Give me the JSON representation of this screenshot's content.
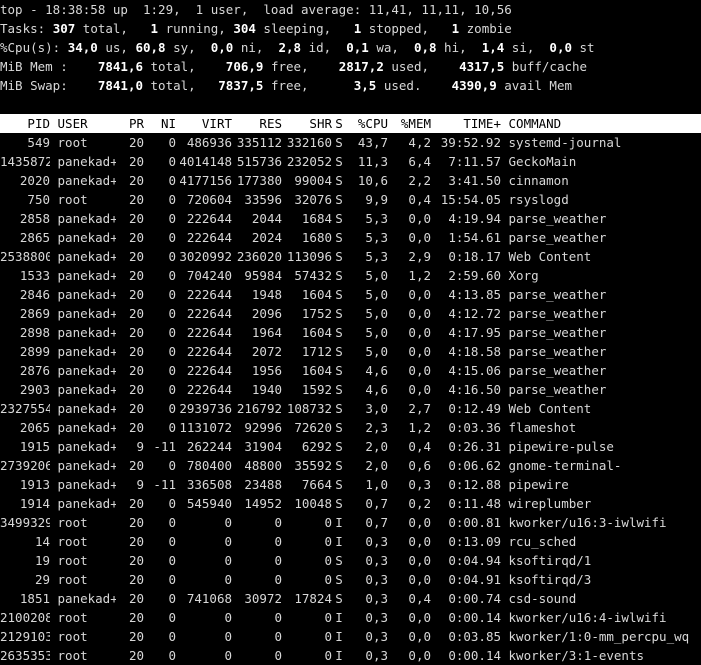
{
  "summary": {
    "line1": "top - 18:38:58 up  1:29,  1 user,  load average: 11,41, 11,11, 10,56",
    "tasks": {
      "label": "Tasks: ",
      "total": "307",
      "total_label": " total,   ",
      "running": "1",
      "running_label": " running, ",
      "sleeping": "304",
      "sleeping_label": " sleeping,   ",
      "stopped": "1",
      "stopped_label": " stopped,   ",
      "zombie": "1",
      "zombie_label": " zombie"
    },
    "cpu": {
      "label": "%Cpu(s): ",
      "us": "34,0",
      "us_label": " us, ",
      "sy": "60,8",
      "sy_label": " sy,  ",
      "ni": "0,0",
      "ni_label": " ni,  ",
      "id": "2,8",
      "id_label": " id,  ",
      "wa": "0,1",
      "wa_label": " wa,  ",
      "hi": "0,8",
      "hi_label": " hi,  ",
      "si": "1,4",
      "si_label": " si,  ",
      "st": "0,0",
      "st_label": " st"
    },
    "mem": {
      "label": "MiB Mem :    ",
      "total": "7841,6",
      "total_label": " total,    ",
      "free": "706,9",
      "free_label": " free,    ",
      "used": "2817,2",
      "used_label": " used,    ",
      "buff": "4317,5",
      "buff_label": " buff/cache"
    },
    "swap": {
      "label": "MiB Swap:    ",
      "total": "7841,0",
      "total_label": " total,   ",
      "free": "7837,5",
      "free_label": " free,      ",
      "used": "3,5",
      "used_label": " used.    ",
      "avail": "4390,9",
      "avail_label": " avail Mem"
    }
  },
  "columns": [
    "PID",
    "USER",
    "PR",
    "NI",
    "VIRT",
    "RES",
    "SHR",
    "S",
    "%CPU",
    "%MEM",
    "TIME+",
    "COMMAND"
  ],
  "processes": [
    [
      "549",
      "root",
      "20",
      "0",
      "486936",
      "335112",
      "332160",
      "S",
      "43,7",
      "4,2",
      "39:52.92",
      "systemd-journal"
    ],
    [
      "1435872",
      "panekad+",
      "20",
      "0",
      "4014148",
      "515736",
      "232052",
      "S",
      "11,3",
      "6,4",
      "7:11.57",
      "GeckoMain"
    ],
    [
      "2020",
      "panekad+",
      "20",
      "0",
      "4177156",
      "177380",
      "99004",
      "S",
      "10,6",
      "2,2",
      "3:41.50",
      "cinnamon"
    ],
    [
      "750",
      "root",
      "20",
      "0",
      "720604",
      "33596",
      "32076",
      "S",
      "9,9",
      "0,4",
      "15:54.05",
      "rsyslogd"
    ],
    [
      "2858",
      "panekad+",
      "20",
      "0",
      "222644",
      "2044",
      "1684",
      "S",
      "5,3",
      "0,0",
      "4:19.94",
      "parse_weather"
    ],
    [
      "2865",
      "panekad+",
      "20",
      "0",
      "222644",
      "2024",
      "1680",
      "S",
      "5,3",
      "0,0",
      "1:54.61",
      "parse_weather"
    ],
    [
      "2538800",
      "panekad+",
      "20",
      "0",
      "3020992",
      "236020",
      "113096",
      "S",
      "5,3",
      "2,9",
      "0:18.17",
      "Web Content"
    ],
    [
      "1533",
      "panekad+",
      "20",
      "0",
      "704240",
      "95984",
      "57432",
      "S",
      "5,0",
      "1,2",
      "2:59.60",
      "Xorg"
    ],
    [
      "2846",
      "panekad+",
      "20",
      "0",
      "222644",
      "1948",
      "1604",
      "S",
      "5,0",
      "0,0",
      "4:13.85",
      "parse_weather"
    ],
    [
      "2869",
      "panekad+",
      "20",
      "0",
      "222644",
      "2096",
      "1752",
      "S",
      "5,0",
      "0,0",
      "4:12.72",
      "parse_weather"
    ],
    [
      "2898",
      "panekad+",
      "20",
      "0",
      "222644",
      "1964",
      "1604",
      "S",
      "5,0",
      "0,0",
      "4:17.95",
      "parse_weather"
    ],
    [
      "2899",
      "panekad+",
      "20",
      "0",
      "222644",
      "2072",
      "1712",
      "S",
      "5,0",
      "0,0",
      "4:18.58",
      "parse_weather"
    ],
    [
      "2876",
      "panekad+",
      "20",
      "0",
      "222644",
      "1956",
      "1604",
      "S",
      "4,6",
      "0,0",
      "4:15.06",
      "parse_weather"
    ],
    [
      "2903",
      "panekad+",
      "20",
      "0",
      "222644",
      "1940",
      "1592",
      "S",
      "4,6",
      "0,0",
      "4:16.50",
      "parse_weather"
    ],
    [
      "2327554",
      "panekad+",
      "20",
      "0",
      "2939736",
      "216792",
      "108732",
      "S",
      "3,0",
      "2,7",
      "0:12.49",
      "Web Content"
    ],
    [
      "2065",
      "panekad+",
      "20",
      "0",
      "1131072",
      "92996",
      "72620",
      "S",
      "2,3",
      "1,2",
      "0:03.36",
      "flameshot"
    ],
    [
      "1915",
      "panekad+",
      "9",
      "-11",
      "262244",
      "31904",
      "6292",
      "S",
      "2,0",
      "0,4",
      "0:26.31",
      "pipewire-pulse"
    ],
    [
      "2739206",
      "panekad+",
      "20",
      "0",
      "780400",
      "48800",
      "35592",
      "S",
      "2,0",
      "0,6",
      "0:06.62",
      "gnome-terminal-"
    ],
    [
      "1913",
      "panekad+",
      "9",
      "-11",
      "336508",
      "23488",
      "7664",
      "S",
      "1,0",
      "0,3",
      "0:12.88",
      "pipewire"
    ],
    [
      "1914",
      "panekad+",
      "20",
      "0",
      "545940",
      "14952",
      "10048",
      "S",
      "0,7",
      "0,2",
      "0:11.48",
      "wireplumber"
    ],
    [
      "3499329",
      "root",
      "20",
      "0",
      "0",
      "0",
      "0",
      "I",
      "0,7",
      "0,0",
      "0:00.81",
      "kworker/u16:3-iwlwifi"
    ],
    [
      "14",
      "root",
      "20",
      "0",
      "0",
      "0",
      "0",
      "I",
      "0,3",
      "0,0",
      "0:13.09",
      "rcu_sched"
    ],
    [
      "19",
      "root",
      "20",
      "0",
      "0",
      "0",
      "0",
      "S",
      "0,3",
      "0,0",
      "0:04.94",
      "ksoftirqd/1"
    ],
    [
      "29",
      "root",
      "20",
      "0",
      "0",
      "0",
      "0",
      "S",
      "0,3",
      "0,0",
      "0:04.91",
      "ksoftirqd/3"
    ],
    [
      "1851",
      "panekad+",
      "20",
      "0",
      "741068",
      "30972",
      "17824",
      "S",
      "0,3",
      "0,4",
      "0:00.74",
      "csd-sound"
    ],
    [
      "2100208",
      "root",
      "20",
      "0",
      "0",
      "0",
      "0",
      "I",
      "0,3",
      "0,0",
      "0:00.14",
      "kworker/u16:4-iwlwifi"
    ],
    [
      "2129103",
      "root",
      "20",
      "0",
      "0",
      "0",
      "0",
      "I",
      "0,3",
      "0,0",
      "0:03.85",
      "kworker/1:0-mm_percpu_wq"
    ],
    [
      "2635353",
      "root",
      "20",
      "0",
      "0",
      "0",
      "0",
      "I",
      "0,3",
      "0,0",
      "0:00.14",
      "kworker/3:1-events"
    ]
  ]
}
